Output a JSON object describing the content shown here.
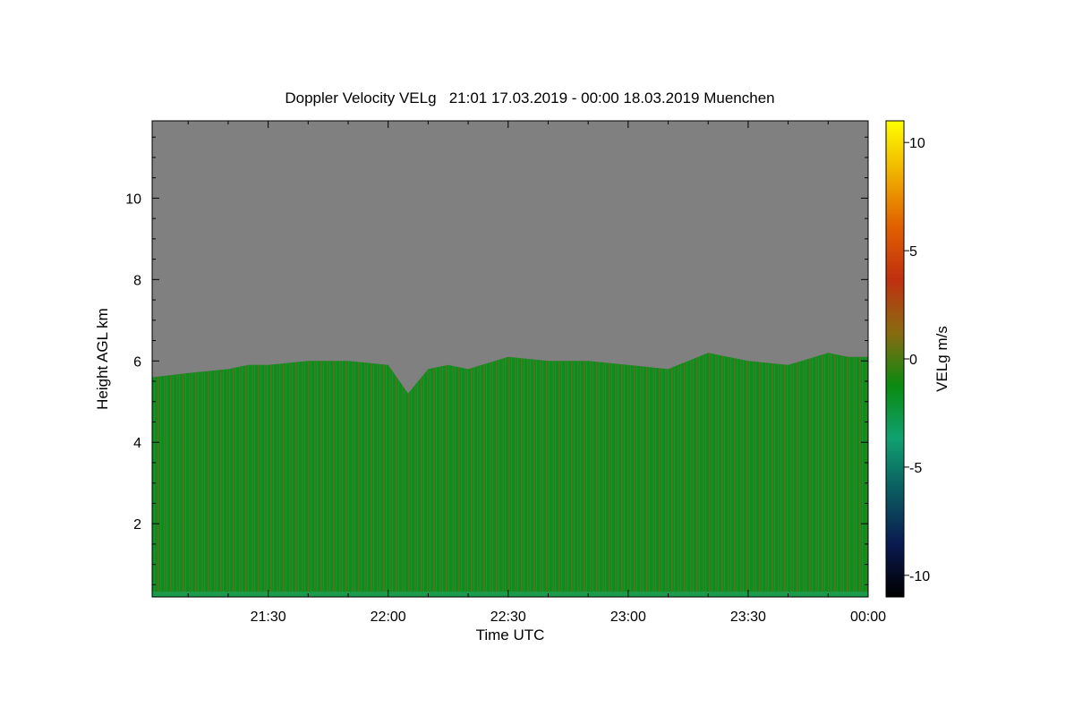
{
  "chart_data": {
    "type": "heatmap",
    "title": "Doppler Velocity VELg   21:01 17.03.2019 - 00:00 18.03.2019 Muenchen",
    "xlabel": "Time UTC",
    "ylabel": "Height AGL km",
    "x_tick_labels": [
      "21:30",
      "22:00",
      "22:30",
      "23:00",
      "23:30",
      "00:00"
    ],
    "x_ticks_min_after_2100": [
      30,
      60,
      90,
      120,
      150,
      180
    ],
    "xlim_min_after_2100": [
      1,
      180
    ],
    "y_ticks": [
      2,
      4,
      6,
      8,
      10
    ],
    "ylim": [
      0.2,
      11.9
    ],
    "colorbar": {
      "label": "VELg m/s",
      "ticks": [
        10,
        5,
        0,
        -5,
        -10
      ],
      "range": [
        -11,
        11
      ],
      "colormap": [
        "#000000",
        "#0a1a50",
        "#0a5a60",
        "#10a070",
        "#0a8a10",
        "#8a6a10",
        "#c03010",
        "#e06000",
        "#f0b000",
        "#ffff00"
      ]
    },
    "background_color": "#808080",
    "echo_top_profile": {
      "time_min_after_2100": [
        1,
        10,
        20,
        25,
        30,
        40,
        50,
        60,
        65,
        70,
        75,
        80,
        90,
        100,
        110,
        120,
        130,
        140,
        150,
        160,
        170,
        175,
        180
      ],
      "top_km": [
        5.6,
        5.7,
        5.8,
        5.9,
        5.9,
        6.0,
        6.0,
        5.9,
        5.2,
        5.8,
        5.9,
        5.8,
        6.1,
        6.0,
        6.0,
        5.9,
        5.8,
        6.2,
        6.0,
        5.9,
        6.2,
        6.1,
        6.1
      ]
    },
    "mean_velocity_in_echo_m_s": -1.5,
    "legend": "colorbar-right",
    "grid": false
  }
}
